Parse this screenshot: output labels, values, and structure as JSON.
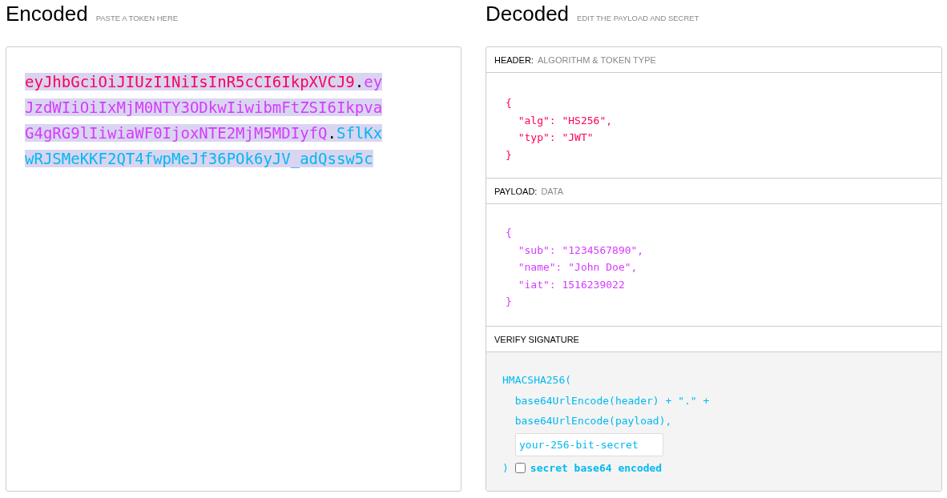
{
  "encoded": {
    "title": "Encoded",
    "subtitle": "PASTE A TOKEN HERE",
    "token": [
      {
        "kind": "header",
        "text": "eyJhbGciOiJIUzI1NiIsInR5cCI6IkpXVCJ9"
      },
      {
        "kind": "dot",
        "text": "."
      },
      {
        "kind": "payload",
        "text": "eyJzdWIiOiIxMjM0NTY3ODkwIiwibmFtZSI6IkpvaG4gRG9lIiwiaWF0IjoxNTE2MjM5MDIyfQ"
      },
      {
        "kind": "dot",
        "text": "."
      },
      {
        "kind": "signature",
        "text": "SflKxwRJSMeKKF2QT4fwpMeJf36POk6yJV_adQssw5c"
      }
    ]
  },
  "decoded": {
    "title": "Decoded",
    "subtitle": "EDIT THE PAYLOAD AND SECRET",
    "header": {
      "label": "HEADER:",
      "hint": "ALGORITHM & TOKEN TYPE",
      "lines": [
        "{",
        "  \"alg\": \"HS256\",",
        "  \"typ\": \"JWT\"",
        "}"
      ]
    },
    "payload": {
      "label": "PAYLOAD:",
      "hint": "DATA",
      "lines": [
        "{",
        "  \"sub\": \"1234567890\",",
        "  \"name\": \"John Doe\",",
        "  \"iat\": 1516239022",
        "}"
      ]
    },
    "signature": {
      "label": "VERIFY SIGNATURE",
      "lines": [
        "HMACSHA256(",
        "  base64UrlEncode(header) + \".\" +",
        "  base64UrlEncode(payload),"
      ],
      "secret": "your-256-bit-secret",
      "close": ")",
      "checkbox_label": "secret base64 encoded",
      "checked": false
    }
  }
}
